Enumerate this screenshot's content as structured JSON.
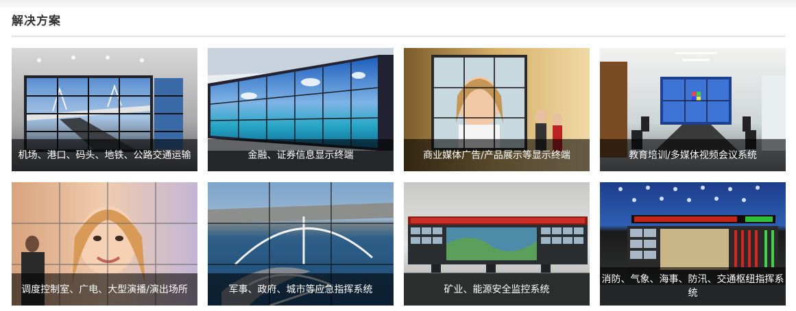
{
  "section": {
    "title": "解决方案"
  },
  "solutions": [
    {
      "caption": "机场、港口、码头、地铁、公路交通运输",
      "image": "video-wall-bridge-highway"
    },
    {
      "caption": "金融、证券信息显示终端",
      "image": "video-wall-ocean-sky"
    },
    {
      "caption": "商业媒体广告/产品展示等显示终端",
      "image": "video-wall-shopping-woman"
    },
    {
      "caption": "教育培训/多媒体视频会议系统",
      "image": "conference-room-windows-wall"
    },
    {
      "caption": "调度控制室、广电、大型演播/演出场所",
      "image": "video-wall-woman-portrait"
    },
    {
      "caption": "军事、政府、城市等应急指挥系统",
      "image": "video-wall-city-bridge-aerial"
    },
    {
      "caption": "矿业、能源安全监控系统",
      "image": "monitoring-center-led-banner"
    },
    {
      "caption": "消防、气象、海事、防汛、交通枢纽指挥系统",
      "image": "command-center-red-led"
    }
  ]
}
